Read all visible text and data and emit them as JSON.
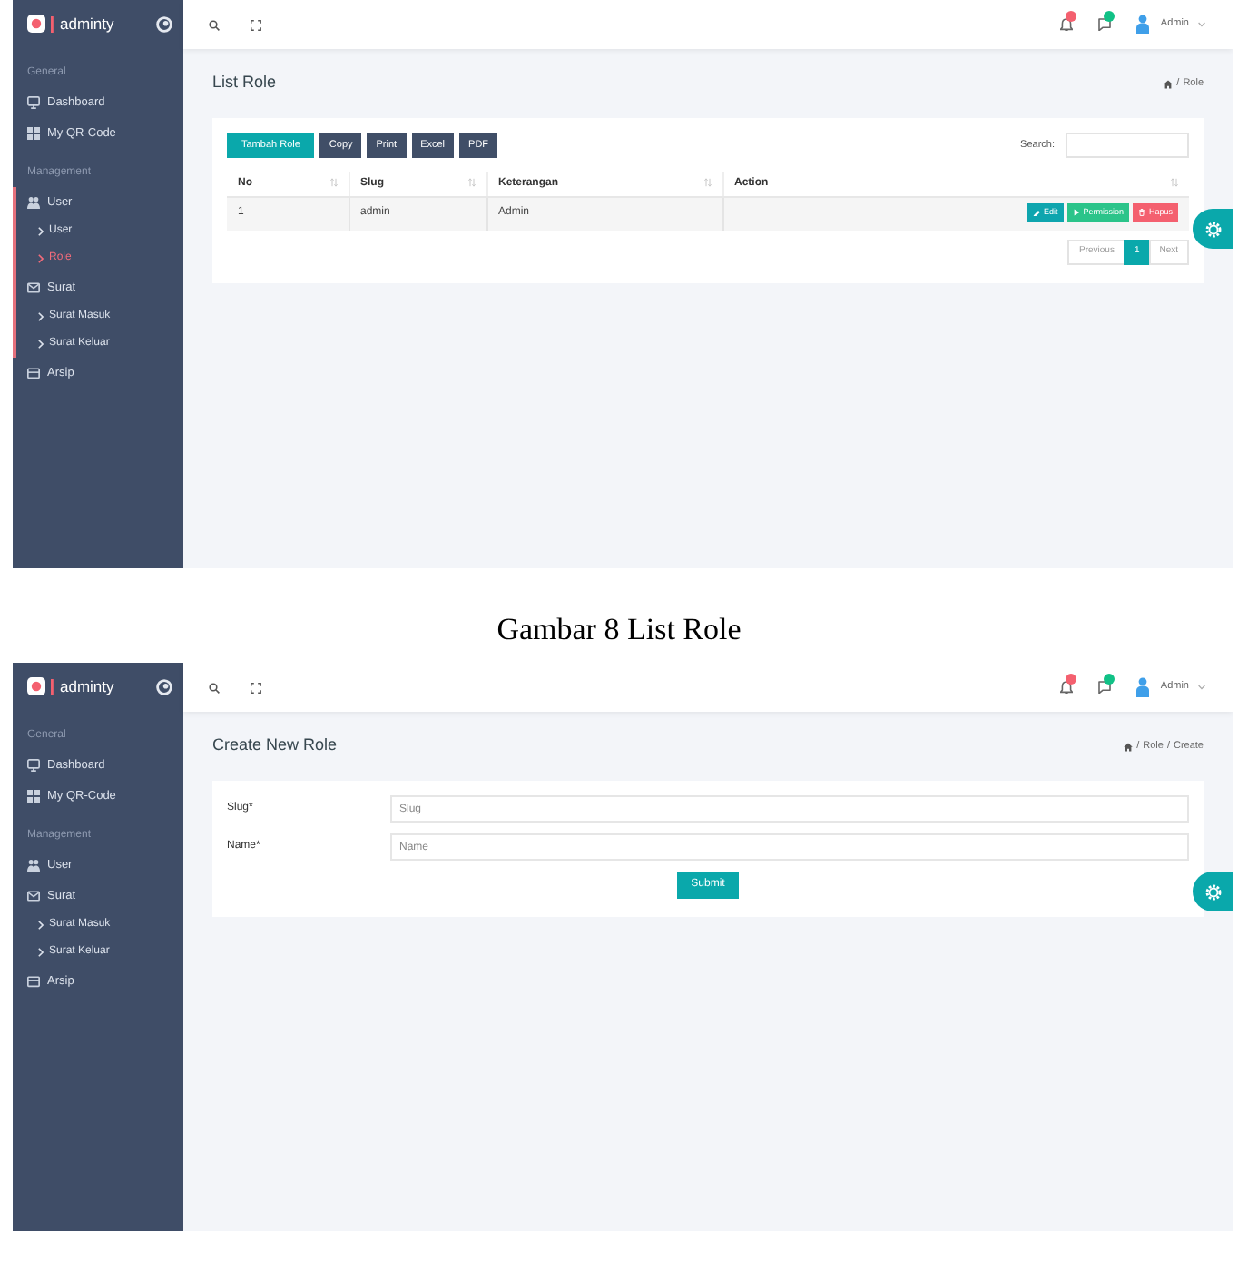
{
  "panels": [
    {
      "kind": "screenshot",
      "sidebar": {
        "logo": "adminty",
        "sections": [
          {
            "caption": "General",
            "items": [
              {
                "label": "Dashboard",
                "selected": false,
                "active": false
              },
              {
                "label": "My QR-Code",
                "selected": false,
                "active": false
              }
            ]
          },
          {
            "caption": "Management",
            "items": [
              {
                "label": "User",
                "selected": false,
                "active": true,
                "children": [
                  {
                    "label": "User",
                    "selected": false
                  },
                  {
                    "label": "Role",
                    "selected": true
                  }
                ]
              },
              {
                "label": "Surat",
                "selected": false,
                "active": true,
                "children": [
                  {
                    "label": "Surat Masuk",
                    "selected": false
                  },
                  {
                    "label": "Surat Keluar",
                    "selected": false
                  }
                ]
              },
              {
                "label": "Arsip",
                "selected": false,
                "active": false
              }
            ]
          }
        ]
      },
      "header": {
        "notifications": [
          {
            "color": "#f4606f"
          },
          {
            "color": "#11c186"
          }
        ],
        "user": "Admin"
      },
      "page": {
        "title": "List Role",
        "breadcrumb": [
          {
            "separator": "/",
            "label": "Role"
          }
        ]
      },
      "content": {
        "kind": "table",
        "toolbar": [
          {
            "label": "Tambah Role",
            "kind": "primary"
          },
          {
            "label": "Copy",
            "kind": "export"
          },
          {
            "label": "Print",
            "kind": "export"
          },
          {
            "label": "Excel",
            "kind": "export"
          },
          {
            "label": "PDF",
            "kind": "export"
          }
        ],
        "search_label": "Search:",
        "columns": [
          "No",
          "Slug",
          "Keterangan",
          "Action"
        ],
        "rows": [
          {
            "cells": [
              "1",
              "admin",
              "Admin"
            ],
            "actions": [
              {
                "label": "Edit",
                "kind": "edit"
              },
              {
                "label": "Permission",
                "kind": "permission"
              },
              {
                "label": "Hapus",
                "kind": "delete"
              }
            ]
          }
        ],
        "pagination": [
          {
            "label": "Previous",
            "selected": false,
            "disabled": true
          },
          {
            "label": "1",
            "selected": true,
            "disabled": false
          },
          {
            "label": "Next",
            "selected": false,
            "disabled": true
          }
        ]
      }
    },
    {
      "kind": "caption",
      "text": "Gambar 8 List Role"
    },
    {
      "kind": "screenshot",
      "sidebar": {
        "logo": "adminty",
        "sections": [
          {
            "caption": "General",
            "items": [
              {
                "label": "Dashboard",
                "selected": false,
                "active": false
              },
              {
                "label": "My QR-Code",
                "selected": false,
                "active": false
              }
            ]
          },
          {
            "caption": "Management",
            "items": [
              {
                "label": "User",
                "selected": false,
                "active": false
              },
              {
                "label": "Surat",
                "selected": false,
                "active": false,
                "children": [
                  {
                    "label": "Surat Masuk",
                    "selected": false
                  },
                  {
                    "label": "Surat Keluar",
                    "selected": false
                  }
                ]
              },
              {
                "label": "Arsip",
                "selected": false,
                "active": false
              }
            ]
          }
        ]
      },
      "header": {
        "notifications": [
          {
            "color": "#f4606f"
          },
          {
            "color": "#11c186"
          }
        ],
        "user": "Admin"
      },
      "page": {
        "title": "Create New Role",
        "breadcrumb": [
          {
            "separator": "/",
            "label": "Role"
          },
          {
            "separator": "/",
            "label": "Create"
          }
        ]
      },
      "content": {
        "kind": "form",
        "fields": [
          {
            "label": "Slug*",
            "placeholder": "Slug"
          },
          {
            "label": "Name*",
            "placeholder": "Name"
          }
        ],
        "submit": "Submit"
      }
    }
  ]
}
